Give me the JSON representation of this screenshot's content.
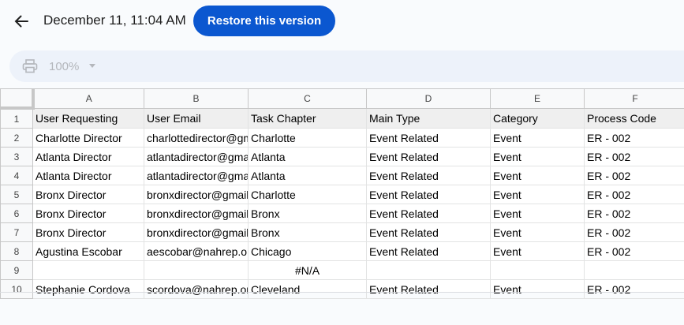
{
  "header": {
    "title": "December 11, 11:04 AM",
    "restore_label": "Restore this version"
  },
  "toolbar": {
    "zoom": "100%"
  },
  "sheet": {
    "columns": [
      "A",
      "B",
      "C",
      "D",
      "E",
      "F"
    ],
    "rows": [
      {
        "num": "1",
        "cells": [
          "User Requesting",
          "User Email",
          "Task Chapter",
          "Main Type",
          "Category",
          "Process Code"
        ]
      },
      {
        "num": "2",
        "cells": [
          "Charlotte Director",
          "charlottedirector@gm",
          "Charlotte",
          "Event Related",
          "Event",
          "ER - 002"
        ]
      },
      {
        "num": "3",
        "cells": [
          "Atlanta Director",
          "atlantadirector@gmai",
          "Atlanta",
          "Event Related",
          "Event",
          "ER - 002"
        ]
      },
      {
        "num": "4",
        "cells": [
          "Atlanta Director",
          "atlantadirector@gmai",
          "Atlanta",
          "Event Related",
          "Event",
          "ER - 002"
        ]
      },
      {
        "num": "5",
        "cells": [
          "Bronx Director",
          "bronxdirector@gmail.",
          "Charlotte",
          "Event Related",
          "Event",
          "ER - 002"
        ]
      },
      {
        "num": "6",
        "cells": [
          "Bronx Director",
          "bronxdirector@gmail.",
          "Bronx",
          "Event Related",
          "Event",
          "ER - 002"
        ]
      },
      {
        "num": "7",
        "cells": [
          "Bronx Director",
          "bronxdirector@gmail.",
          "Bronx",
          "Event Related",
          "Event",
          "ER - 002"
        ]
      },
      {
        "num": "8",
        "cells": [
          "Agustina Escobar",
          "aescobar@nahrep.org",
          "Chicago",
          "Event Related",
          "Event",
          "ER - 002"
        ]
      },
      {
        "num": "9",
        "cells": [
          "",
          "",
          "#N/A",
          "",
          "",
          ""
        ]
      },
      {
        "num": "10",
        "cells": [
          "Stephanie Cordova",
          "scordova@nahrep.org",
          "Cleveland",
          "Event Related",
          "Event",
          "ER - 002"
        ]
      }
    ]
  },
  "colors": {
    "accent": "#0b57d0",
    "toolbar_bg": "#edf2fa",
    "header_row_bg": "#efefef"
  },
  "icons": {
    "back": "arrow-left-icon",
    "print": "printer-icon",
    "zoom_dropdown": "caret-down-icon"
  }
}
